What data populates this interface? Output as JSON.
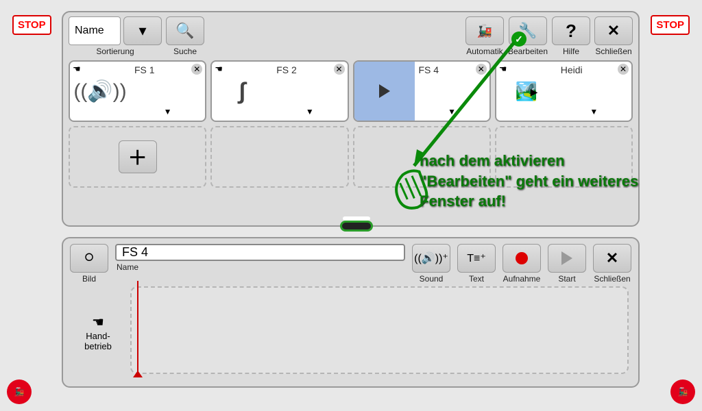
{
  "stop_label": "STOP",
  "top": {
    "name_field": "Name",
    "sort_label": "Sortierung",
    "search_label": "Suche",
    "automatik_label": "Automatik",
    "edit_label": "Bearbeiten",
    "help_label": "Hilfe",
    "close_label": "Schließen",
    "events": [
      {
        "name": "FS 1",
        "icon": "sound",
        "selected": false
      },
      {
        "name": "FS 2",
        "icon": "route",
        "selected": false
      },
      {
        "name": "FS 4",
        "icon": "play",
        "selected": true
      },
      {
        "name": "Heidi",
        "icon": "image",
        "selected": false
      }
    ]
  },
  "bottom": {
    "bild_label": "Bild",
    "name_label": "Name",
    "name_value": "FS 4",
    "sound_label": "Sound",
    "text_label": "Text",
    "record_label": "Aufnahme",
    "start_label": "Start",
    "close_label": "Schließen",
    "hand_label": "Hand-\nbetrieb"
  },
  "annotation": "nach dem aktivieren \"Bearbeiten\" geht ein weiteres Fenster auf!"
}
